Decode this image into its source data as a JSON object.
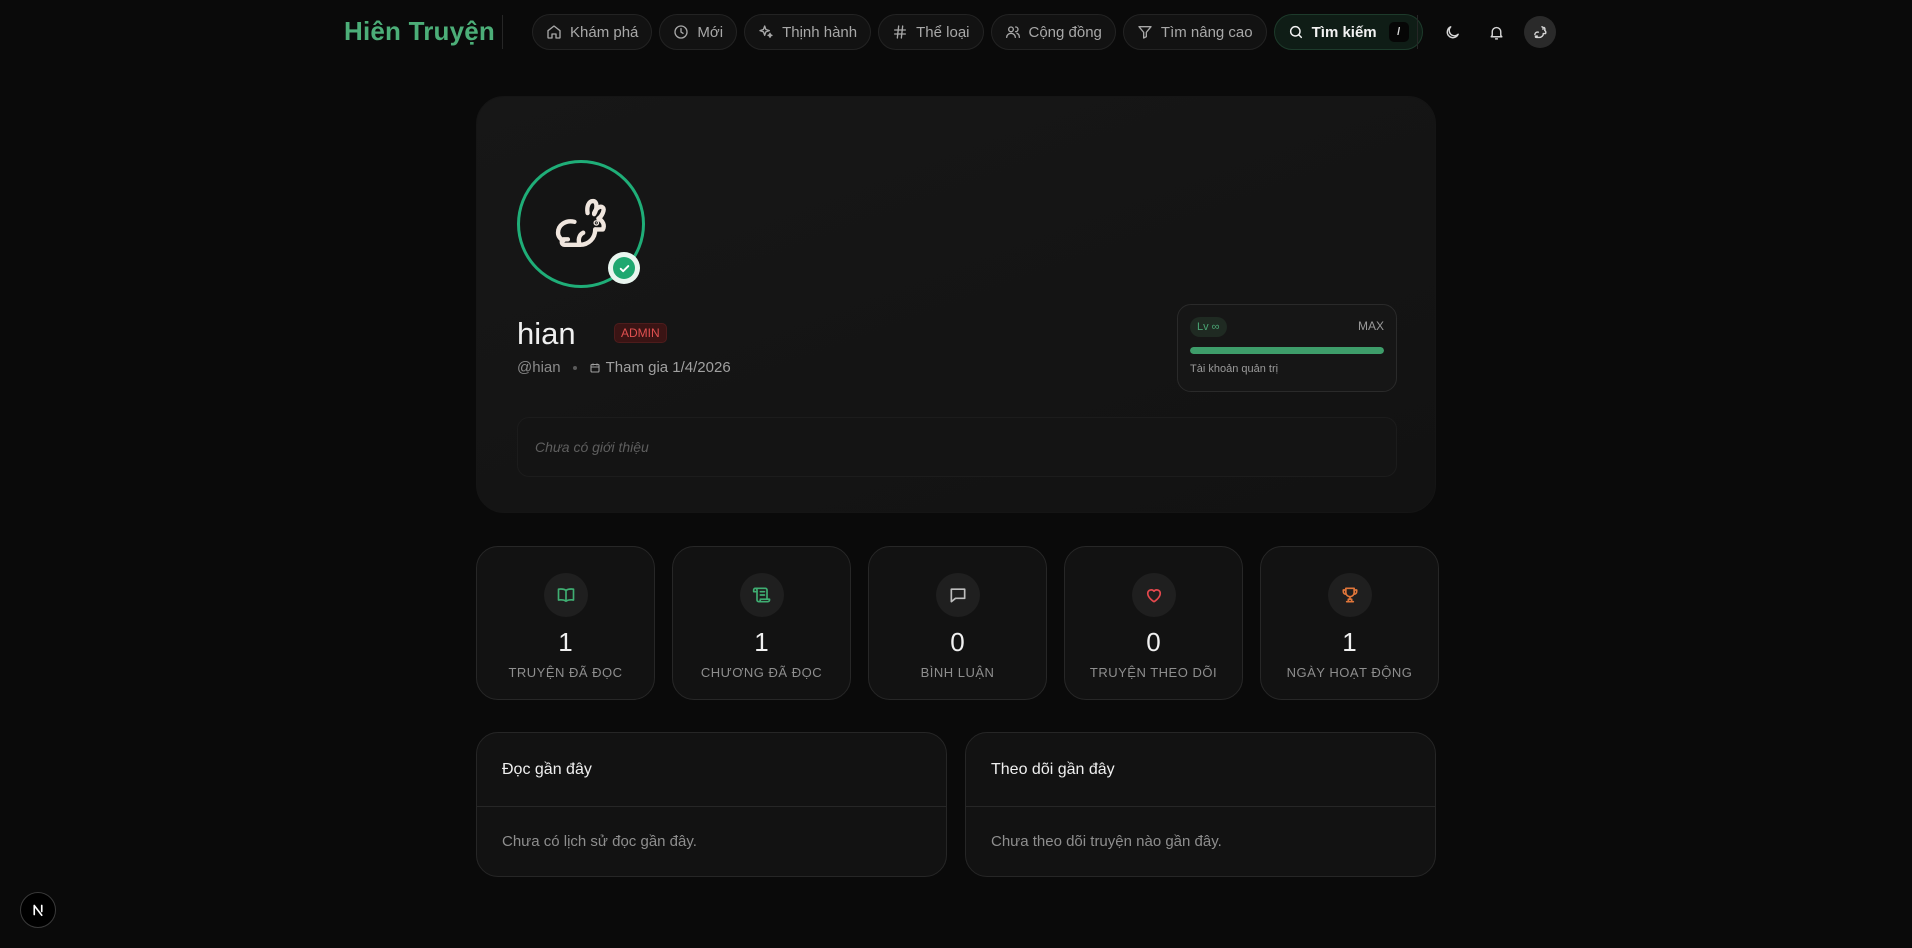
{
  "header": {
    "logo": "Hiên Truyện",
    "nav": [
      {
        "label": "Khám phá",
        "icon": "home-icon"
      },
      {
        "label": "Mới",
        "icon": "clock-icon"
      },
      {
        "label": "Thịnh hành",
        "icon": "sparkles-icon"
      },
      {
        "label": "Thể loại",
        "icon": "hash-icon"
      },
      {
        "label": "Cộng đồng",
        "icon": "users-icon"
      },
      {
        "label": "Tìm nâng cao",
        "icon": "filter-icon"
      }
    ],
    "search": {
      "label": "Tìm kiếm",
      "shortcut": "/",
      "icon": "search-icon"
    },
    "actions": [
      "moon-icon",
      "bell-icon",
      "avatar-rabbit-icon"
    ]
  },
  "profile": {
    "display_name": "hian",
    "role": "ADMIN",
    "handle": "@hian",
    "joined": "Tham gia 1/4/2026",
    "bio_placeholder": "Chưa có giới thiệu",
    "level": {
      "label": "Lv ∞",
      "max_text": "MAX",
      "progress": 1.0,
      "description": "Tài khoản quản trị"
    }
  },
  "stats": [
    {
      "value": "1",
      "label": "TRUYỆN ĐÃ ĐỌC",
      "icon": "book-open-icon",
      "color": "#3fae72"
    },
    {
      "value": "1",
      "label": "CHƯƠNG ĐÃ ĐỌC",
      "icon": "scroll-icon",
      "color": "#3fae72"
    },
    {
      "value": "0",
      "label": "BÌNH LUẬN",
      "icon": "message-icon",
      "color": "#bdbdbd"
    },
    {
      "value": "0",
      "label": "TRUYỆN THEO DÕI",
      "icon": "heart-icon",
      "color": "#e5484d"
    },
    {
      "value": "1",
      "label": "NGÀY HOẠT ĐỘNG",
      "icon": "trophy-icon",
      "color": "#e0763a"
    }
  ],
  "recent_reading": {
    "title": "Đọc gần đây",
    "empty": "Chưa có lịch sử đọc gần đây."
  },
  "recent_following": {
    "title": "Theo dõi gần đây",
    "empty": "Chưa theo dõi truyện nào gần đây."
  },
  "colors": {
    "accent": "#4cae78",
    "avatar_ring": "#1fae78",
    "admin_badge": "#e05050",
    "background": "#0a0a0a"
  }
}
